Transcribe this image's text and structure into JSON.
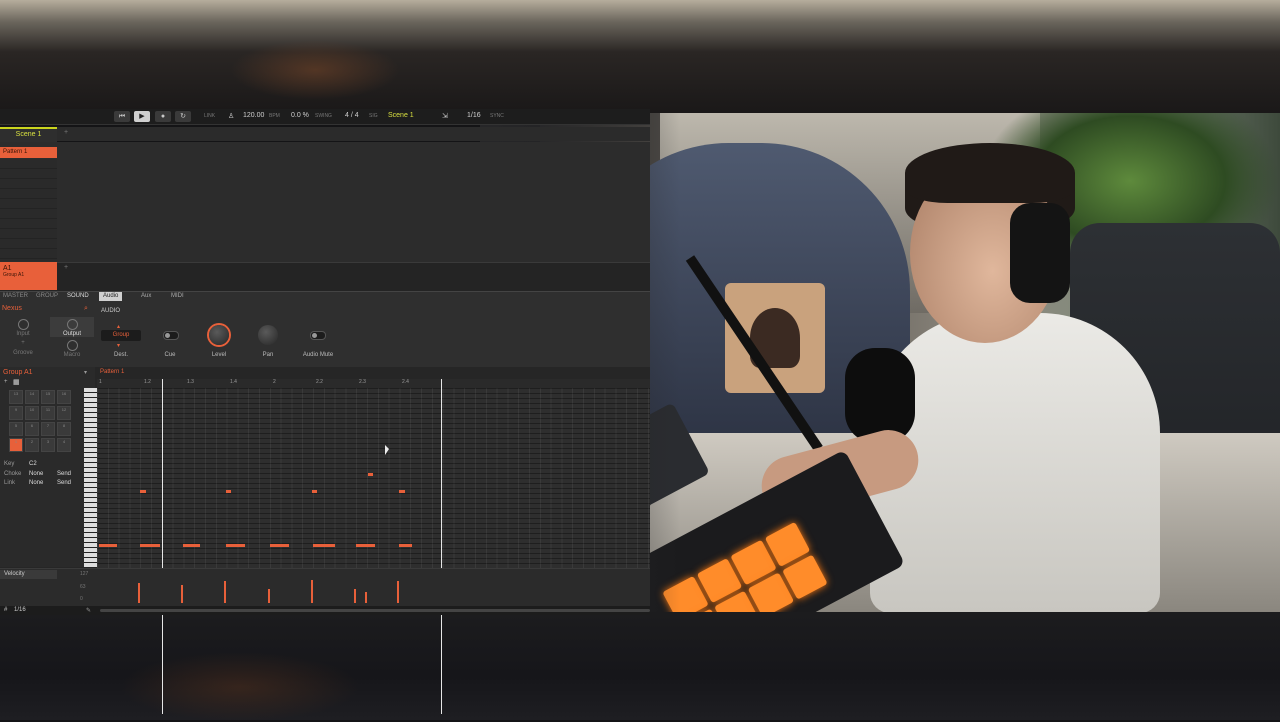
{
  "transport": {
    "tempo": "120.00",
    "tempo_unit": "BPM",
    "swing": "0.0 %",
    "swing_label": "SWING",
    "signature": "4 / 4",
    "sig_label": "SIG",
    "scene": "Scene 1",
    "grid": "1/16",
    "sync_label": "SYNC",
    "link_label": "LINK"
  },
  "scenes": {
    "tab": "Scene 1",
    "add": "+"
  },
  "arranger": {
    "pattern": "Pattern 1"
  },
  "group": {
    "id": "A1",
    "name": "Group A1",
    "add": "+"
  },
  "panel": {
    "tabs": [
      "MASTER",
      "GROUP",
      "SOUND"
    ],
    "subtabs": [
      "Audio",
      "Aux",
      "MIDI"
    ],
    "sound_name": "Nexus",
    "section": "AUDIO",
    "nav": [
      "Input",
      "Output",
      "Groove",
      "Macro"
    ],
    "dest_value": "Group",
    "controls": [
      "Dest.",
      "Cue",
      "Level",
      "Pan",
      "Audio Mute"
    ]
  },
  "editor": {
    "group_title": "Group A1",
    "pattern": "Pattern 1",
    "pads": [
      "13",
      "14",
      "15",
      "16",
      "9",
      "10",
      "11",
      "12",
      "5",
      "6",
      "7",
      "8",
      "1",
      "2",
      "3",
      "4"
    ],
    "props": [
      {
        "k": "Key",
        "v": "C2",
        "s": ""
      },
      {
        "k": "Choke",
        "v": "None",
        "s": "Send"
      },
      {
        "k": "Link",
        "v": "None",
        "s": "Send"
      }
    ],
    "ruler": [
      "1",
      "1.2",
      "1.3",
      "1.4",
      "2",
      "2.2",
      "2.3",
      "2.4"
    ],
    "velocity_label": "Velocity",
    "vel_ticks": [
      "127",
      "63",
      "0"
    ],
    "grid_res": "1/16"
  },
  "colors": {
    "accent": "#e8603a",
    "scene": "#c9d41e"
  }
}
